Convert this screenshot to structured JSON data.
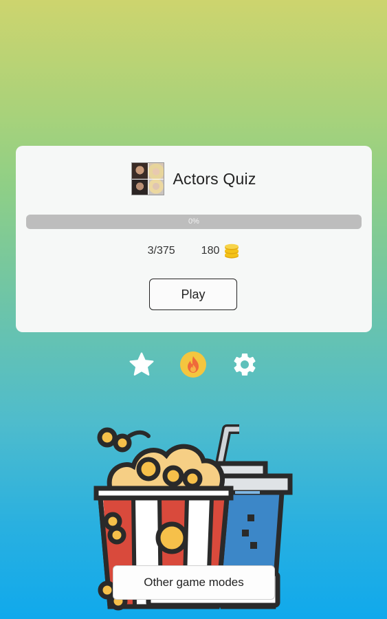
{
  "quiz": {
    "title": "Actors Quiz",
    "progress_label": "0%",
    "progress_fraction": 0,
    "solved_count": "3/375",
    "coins": "180",
    "play_label": "Play"
  },
  "actions": {
    "icons": [
      "star-icon",
      "fire-icon",
      "gear-icon"
    ]
  },
  "footer": {
    "other_modes_label": "Other game modes"
  },
  "colors": {
    "card_background": "#f6f8f7",
    "progress_track": "#bdbdbd",
    "fire_badge": "#f4c63f",
    "fire_flame": "#ef6a3a",
    "coin": "#f4c318",
    "gradient_top": "#cdd46e",
    "gradient_bottom": "#10a9ec"
  }
}
